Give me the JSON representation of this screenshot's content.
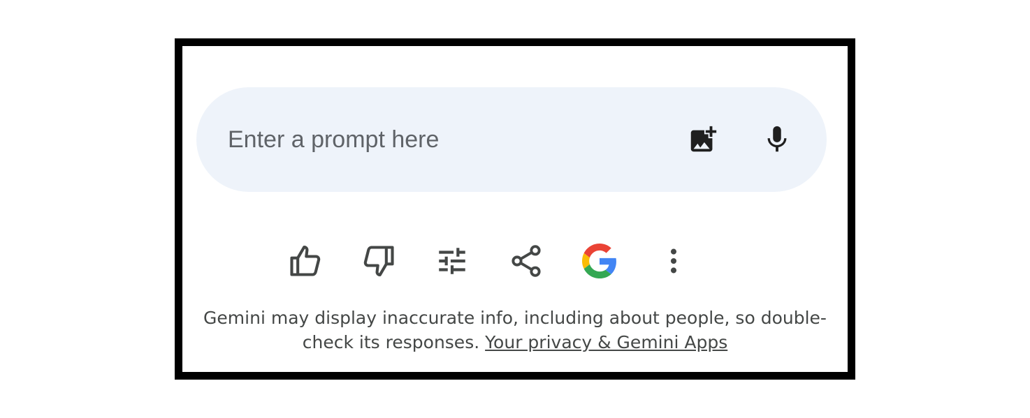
{
  "prompt": {
    "placeholder": "Enter a prompt here",
    "image_button_icon": "add-photo-icon",
    "mic_button_icon": "mic-icon"
  },
  "actions": [
    {
      "icon": "thumb-up-icon"
    },
    {
      "icon": "thumb-down-icon"
    },
    {
      "icon": "tune-icon"
    },
    {
      "icon": "share-icon"
    },
    {
      "icon": "google-icon"
    },
    {
      "icon": "more-vert-icon"
    }
  ],
  "disclaimer": {
    "text_line1": "Gemini may display inaccurate info, including about people, so double-",
    "text_line2": "check its responses. ",
    "link": "Your privacy & Gemini Apps"
  },
  "colors": {
    "frame_border": "#000000",
    "prompt_bg": "#eef3fa",
    "placeholder": "#5f6368",
    "icon": "#444746",
    "google_blue": "#4285F4",
    "google_red": "#EA4335",
    "google_yellow": "#FBBC05",
    "google_green": "#34A853"
  }
}
